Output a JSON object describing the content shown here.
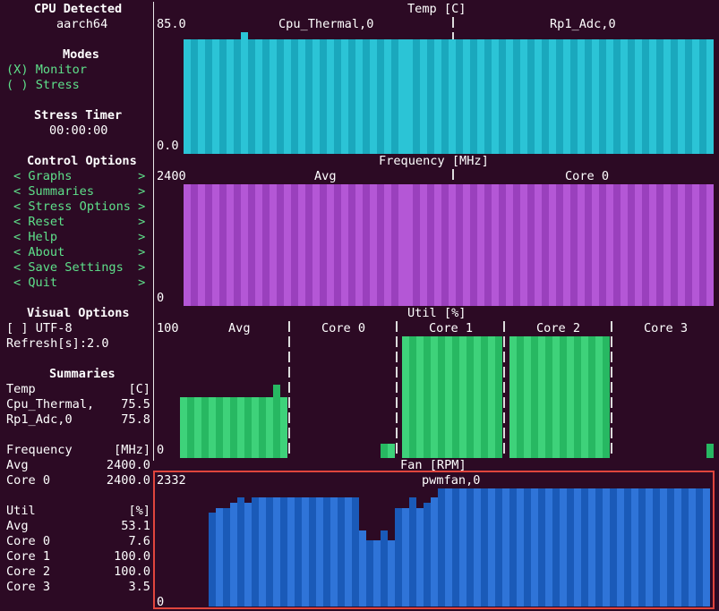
{
  "sidebar": {
    "cpu_title": "CPU Detected",
    "cpu_value": "aarch64",
    "modes_title": "Modes",
    "modes": [
      {
        "label": "(X) Monitor"
      },
      {
        "label": "( ) Stress"
      }
    ],
    "stress_timer_title": "Stress Timer",
    "stress_timer_value": "00:00:00",
    "control_title": "Control Options",
    "controls": [
      {
        "label": "< Graphs         >"
      },
      {
        "label": "< Summaries      >"
      },
      {
        "label": "< Stress Options >"
      },
      {
        "label": "< Reset          >"
      },
      {
        "label": "< Help           >"
      },
      {
        "label": "< About          >"
      },
      {
        "label": "< Save Settings  >"
      },
      {
        "label": "< Quit           >"
      }
    ],
    "visual_title": "Visual Options",
    "visual": [
      {
        "label": "[ ] UTF-8"
      },
      {
        "label": "Refresh[s]:2.0"
      }
    ],
    "summaries_title": "Summaries",
    "summaries": [
      {
        "name": "Temp",
        "value": "[C]"
      },
      {
        "name": "Cpu_Thermal,",
        "value": "75.5"
      },
      {
        "name": "Rp1_Adc,0",
        "value": "75.8"
      },
      {
        "name": "",
        "value": ""
      },
      {
        "name": "Frequency",
        "value": "[MHz]"
      },
      {
        "name": "Avg",
        "value": "2400.0"
      },
      {
        "name": "Core 0",
        "value": "2400.0"
      },
      {
        "name": "",
        "value": ""
      },
      {
        "name": "Util",
        "value": "[%]"
      },
      {
        "name": "Avg",
        "value": "53.1"
      },
      {
        "name": "Core 0",
        "value": "7.6"
      },
      {
        "name": "Core 1",
        "value": "100.0"
      },
      {
        "name": "Core 2",
        "value": "100.0"
      },
      {
        "name": "Core 3",
        "value": "3.5"
      }
    ]
  },
  "graphs": {
    "temp": {
      "title": "Temp [C]",
      "ymax": "85.0",
      "ymin": "0.0",
      "series": [
        "Cpu_Thermal,0",
        "Rp1_Adc,0"
      ],
      "color": "#2bc4d6",
      "color_alt": "#1aa8bd"
    },
    "freq": {
      "title": "Frequency [MHz]",
      "ymax": "2400",
      "ymin": "0",
      "series": [
        "Avg",
        "Core 0"
      ],
      "color": "#b457d6",
      "color_alt": "#9a40bd"
    },
    "util": {
      "title": "Util [%]",
      "ymax": "100",
      "ymin": "0",
      "series": [
        "Avg",
        "Core 0",
        "Core 1",
        "Core 2",
        "Core 3"
      ],
      "color": "#3ed27a",
      "color_alt": "#27b862"
    },
    "fan": {
      "title": "Fan [RPM]",
      "ymax": "2332",
      "ymin": "0",
      "series": [
        "pwmfan,0"
      ],
      "color": "#2f74d8",
      "color_alt": "#1a5ab8"
    }
  },
  "chart_data": [
    {
      "type": "bar",
      "title": "Temp [C]",
      "series": [
        {
          "name": "Cpu_Thermal,0",
          "values": [
            80,
            80,
            80,
            80,
            80,
            80,
            80,
            80,
            85,
            80,
            80,
            80,
            80,
            80,
            80,
            80,
            80,
            80,
            80,
            80,
            80,
            80,
            80,
            80,
            80,
            80,
            80,
            80,
            80,
            80,
            80,
            80,
            80,
            80,
            80,
            80,
            80
          ]
        },
        {
          "name": "Rp1_Adc,0",
          "values": [
            80,
            80,
            80,
            80,
            80,
            80,
            80,
            80,
            80,
            80,
            80,
            80,
            80,
            80,
            80,
            80,
            80,
            80,
            80,
            80,
            80,
            80,
            80,
            80,
            80,
            80,
            80,
            80,
            80,
            80,
            80,
            80,
            80,
            80,
            80,
            80,
            80,
            80,
            80,
            80,
            80,
            80,
            80
          ]
        }
      ],
      "ylim": [
        0,
        85
      ]
    },
    {
      "type": "bar",
      "title": "Frequency [MHz]",
      "series": [
        {
          "name": "Avg",
          "values": [
            2400,
            2400,
            2400,
            2400,
            2400,
            2400,
            2400,
            2400,
            2400,
            2400,
            2400,
            2400,
            2400,
            2400,
            2400,
            2400,
            2400,
            2400,
            2400,
            2400,
            2400,
            2400,
            2400,
            2400,
            2400,
            2400,
            2400,
            2400,
            2400,
            2400,
            2400,
            2400,
            2400,
            2400,
            2400,
            2400,
            2400
          ]
        },
        {
          "name": "Core 0",
          "values": [
            2400,
            2400,
            2400,
            2400,
            2400,
            2400,
            2400,
            2400,
            2400,
            2400,
            2400,
            2400,
            2400,
            2400,
            2400,
            2400,
            2400,
            2400,
            2400,
            2400,
            2400,
            2400,
            2400,
            2400,
            2400,
            2400,
            2400,
            2400,
            2400,
            2400,
            2400,
            2400,
            2400,
            2400,
            2400,
            2400,
            2400,
            2400,
            2400,
            2400,
            2400,
            2400,
            2400
          ]
        }
      ],
      "ylim": [
        0,
        2400
      ]
    },
    {
      "type": "bar",
      "title": "Util [%]",
      "series": [
        {
          "name": "Avg",
          "values": [
            50,
            50,
            50,
            50,
            50,
            50,
            50,
            50,
            50,
            50,
            50,
            50,
            50,
            60,
            50
          ]
        },
        {
          "name": "Core 0",
          "values": [
            0,
            0,
            0,
            0,
            0,
            0,
            0,
            0,
            0,
            0,
            0,
            0,
            0,
            0,
            0,
            12,
            12
          ]
        },
        {
          "name": "Core 1",
          "values": [
            100,
            100,
            100,
            100,
            100,
            100,
            100,
            100,
            100,
            100,
            100,
            100,
            100,
            100
          ]
        },
        {
          "name": "Core 2",
          "values": [
            100,
            100,
            100,
            100,
            100,
            100,
            100,
            100,
            100,
            100,
            100,
            100,
            100,
            100
          ]
        },
        {
          "name": "Core 3",
          "values": [
            0,
            0,
            0,
            0,
            0,
            0,
            0,
            0,
            0,
            0,
            0,
            0,
            0,
            0,
            0,
            0,
            0,
            0,
            0,
            0,
            0,
            0,
            0,
            0,
            0,
            0,
            0,
            0,
            0,
            0,
            0,
            0,
            0,
            0,
            0,
            0,
            0,
            12
          ]
        }
      ],
      "ylim": [
        0,
        100
      ]
    },
    {
      "type": "bar",
      "title": "Fan [RPM]",
      "series": [
        {
          "name": "pwmfan,0",
          "values": [
            0,
            0,
            0,
            0,
            0,
            1850,
            1950,
            1950,
            2050,
            2150,
            2050,
            2150,
            2150,
            2150,
            2150,
            2150,
            2150,
            2150,
            2150,
            2150,
            2150,
            2150,
            2150,
            2150,
            2150,
            2150,
            1500,
            1300,
            1300,
            1500,
            1300,
            1950,
            1950,
            2150,
            1950,
            2050,
            2150,
            2332,
            2332,
            2332,
            2332,
            2332,
            2332,
            2332,
            2332,
            2332,
            2332,
            2332,
            2332,
            2332,
            2332,
            2332,
            2332,
            2332,
            2332,
            2332,
            2332,
            2332,
            2332,
            2332,
            2332,
            2332,
            2332,
            2332,
            2332,
            2332,
            2332,
            2332,
            2332,
            2332,
            2332,
            2332,
            2332,
            2332,
            2332
          ]
        }
      ],
      "ylim": [
        0,
        2332
      ]
    }
  ]
}
